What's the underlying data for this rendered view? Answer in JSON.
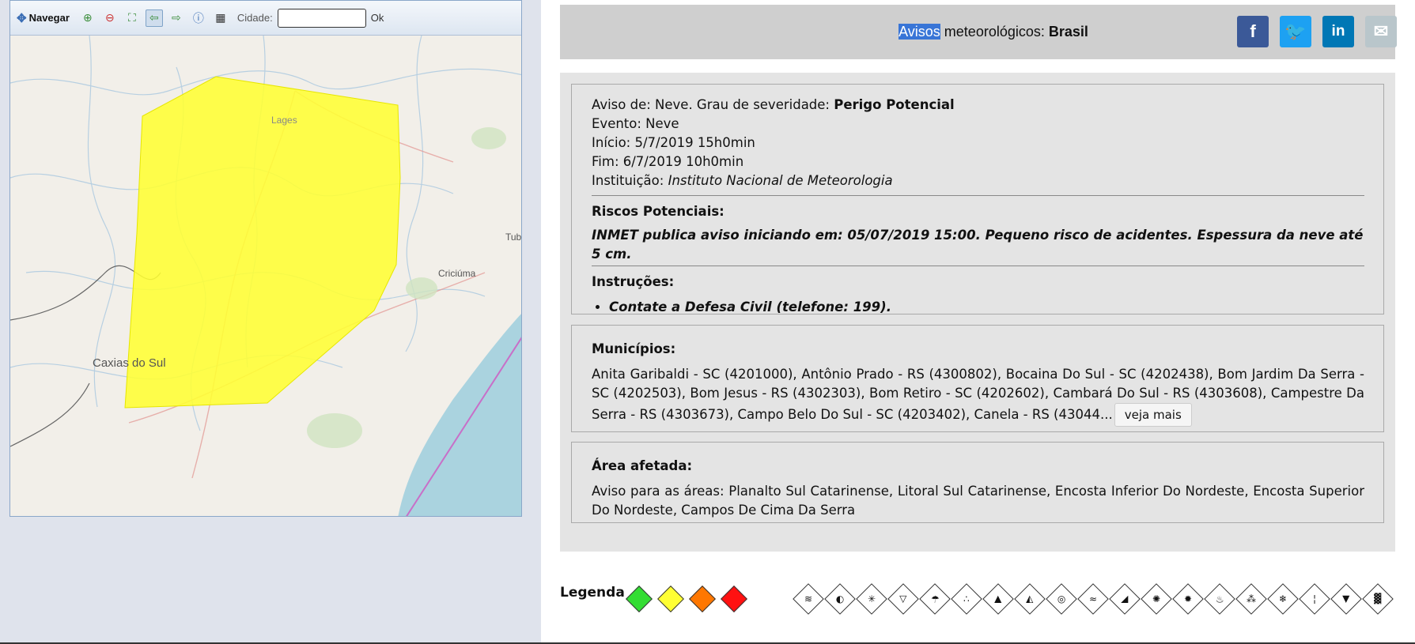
{
  "map": {
    "toolbar": {
      "nav_label": "Navegar",
      "cidade_label": "Cidade:",
      "ok_label": "Ok",
      "cidade_value": ""
    },
    "places": {
      "lages": "Lages",
      "caxias": "Caxias do Sul",
      "criciuma": "Criciúma",
      "tub": "Tub"
    },
    "alert_color": "#ffff33"
  },
  "header": {
    "title_hl": "Avisos",
    "title_rest": " meteorológicos: ",
    "title_region": "Brasil"
  },
  "share": [
    {
      "name": "facebook",
      "glyph": "f",
      "color": "#3b5998"
    },
    {
      "name": "twitter",
      "glyph": "t",
      "color": "#1da1f2"
    },
    {
      "name": "linkedin",
      "glyph": "in",
      "color": "#0077b5"
    },
    {
      "name": "email",
      "glyph": "✉",
      "color": "#b9c6cb"
    }
  ],
  "alert": {
    "aviso_prefix": "Aviso de: Neve. Grau de severidade: ",
    "severity": "Perigo Potencial",
    "evento": "Evento: Neve",
    "inicio": "Início: 5/7/2019 15h0min",
    "fim": "Fim: 6/7/2019 10h0min",
    "instituicao_label": "Instituição: ",
    "instituicao": "Instituto Nacional de Meteorologia",
    "riscos_title": "Riscos Potenciais:",
    "riscos_text": "INMET publica aviso iniciando em: 05/07/2019 15:00. Pequeno risco de acidentes. Espessura da neve até 5 cm.",
    "instrucoes_title": "Instruções:",
    "instrucoes": [
      "Contate a Defesa Civil (telefone: 199)."
    ]
  },
  "municipios": {
    "title": "Municípios:",
    "text": "Anita Garibaldi - SC (4201000), Antônio Prado - RS (4300802), Bocaina Do Sul - SC (4202438), Bom Jardim Da Serra - SC (4202503), Bom Jesus - RS (4302303), Bom Retiro - SC (4202602), Cambará Do Sul - RS (4303608), Campestre Da Serra - RS (4303673), Campo Belo Do Sul - SC (4203402), Canela - RS (43044...",
    "more_label": "veja mais"
  },
  "area": {
    "title": "Área afetada:",
    "text": "Aviso para as áreas: Planalto Sul Catarinense, Litoral Sul Catarinense, Encosta Inferior Do Nordeste, Encosta Superior Do Nordeste, Campos De Cima Da Serra"
  },
  "legend": {
    "label": "Legenda",
    "severity_colors": [
      "#33dd33",
      "#ffff33",
      "#ff7700",
      "#ff1111"
    ],
    "hazard_icons": [
      "wind-icon",
      "cyclone-icon",
      "snow-icon",
      "frost-icon",
      "rain-icon",
      "hail-icon",
      "storm-icon",
      "heat-icon",
      "fog-icon",
      "air-quality-icon",
      "waves-icon",
      "landslide-icon",
      "coastal-icon",
      "flood-icon",
      "fire-icon",
      "drought-icon",
      "ice-icon",
      "cold-icon",
      "temperature-icon",
      "thunderstorm-icon",
      "dust-icon"
    ]
  }
}
